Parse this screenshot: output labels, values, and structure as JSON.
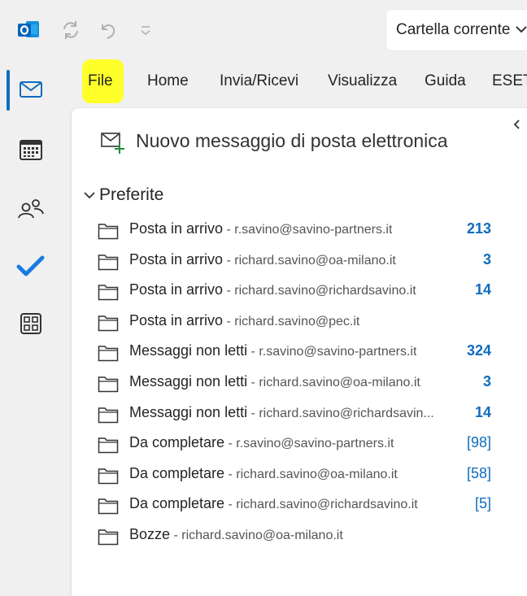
{
  "search": {
    "scope_label": "Cartella corrente"
  },
  "tabs": [
    {
      "label": "File"
    },
    {
      "label": "Home"
    },
    {
      "label": "Invia/Ricevi"
    },
    {
      "label": "Visualizza"
    },
    {
      "label": "Guida"
    },
    {
      "label": "ESET"
    }
  ],
  "rail": {
    "items": [
      {
        "icon": "mail-icon",
        "active": true
      },
      {
        "icon": "calendar-icon",
        "active": false
      },
      {
        "icon": "people-icon",
        "active": false
      },
      {
        "icon": "todo-check-icon",
        "active": false
      },
      {
        "icon": "apps-grid-icon",
        "active": false
      }
    ]
  },
  "pane": {
    "new_message_label": "Nuovo messaggio di posta elettronica",
    "favorites_label": "Preferite",
    "folders": [
      {
        "name": "Posta in arrivo",
        "sep": " - ",
        "account": "r.savino@savino-partners.it",
        "count": "213",
        "count_style": "bold"
      },
      {
        "name": "Posta in arrivo",
        "sep": " - ",
        "account": "richard.savino@oa-milano.it",
        "count": "3",
        "count_style": "bold"
      },
      {
        "name": "Posta in arrivo",
        "sep": " - ",
        "account": "richard.savino@richardsavino.it",
        "count": "14",
        "count_style": "bold"
      },
      {
        "name": "Posta in arrivo",
        "sep": " - ",
        "account": "richard.savino@pec.it",
        "count": "",
        "count_style": "bold"
      },
      {
        "name": "Messaggi non letti",
        "sep": " - ",
        "account": "r.savino@savino-partners.it",
        "count": "324",
        "count_style": "bold"
      },
      {
        "name": "Messaggi non letti",
        "sep": " - ",
        "account": "richard.savino@oa-milano.it",
        "count": "3",
        "count_style": "bold"
      },
      {
        "name": "Messaggi non letti",
        "sep": " - ",
        "account": "richard.savino@richardsavin...",
        "count": "14",
        "count_style": "bold"
      },
      {
        "name": "Da completare",
        "sep": " - ",
        "account": "r.savino@savino-partners.it",
        "count": "[98]",
        "count_style": "normal"
      },
      {
        "name": "Da completare",
        "sep": " - ",
        "account": "richard.savino@oa-milano.it",
        "count": "[58]",
        "count_style": "normal"
      },
      {
        "name": "Da completare",
        "sep": " - ",
        "account": "richard.savino@richardsavino.it",
        "count": "[5]",
        "count_style": "normal"
      },
      {
        "name": "Bozze",
        "sep": " - ",
        "account": "richard.savino@oa-milano.it",
        "count": "",
        "count_style": "normal"
      }
    ]
  },
  "colors": {
    "accent": "#0f6cbd",
    "highlight": "#ffff29",
    "pane_bg": "#ffffff",
    "app_bg": "#f0f0f0"
  }
}
